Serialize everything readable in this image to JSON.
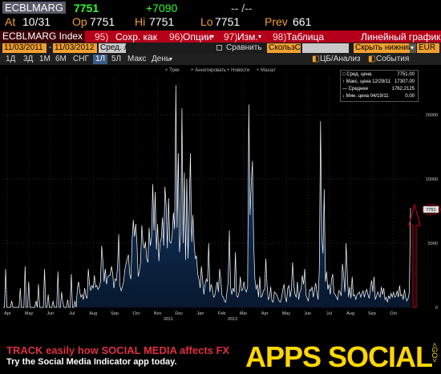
{
  "quote": {
    "ticker": "ECBLMARG",
    "last": "7751",
    "change": "+7090",
    "dash": "-- /--",
    "at_label": "At",
    "at": "10/31",
    "op_label": "Op",
    "op": "7751",
    "hi_label": "Hi",
    "hi": "7751",
    "lo_label": "Lo",
    "lo": "7751",
    "prev_label": "Prev",
    "prev": "661"
  },
  "menu": {
    "security": "ECBLMARG Index",
    "save_num": "95)",
    "save": "Сохр. как",
    "options_num": "96)",
    "options": "Опции",
    "edit_num": "97)",
    "edit": "Изм.",
    "table_num": "98)",
    "table": "Таблица",
    "chart_type": "Линейный график"
  },
  "range": {
    "start": "11/03/2011",
    "end": "11/03/2012",
    "avg_lines": "Сред. линия",
    "compare": "Сравнить",
    "moving_avg": "СкользСр",
    "hide_lower": "Скрыть нижний",
    "currency": "EUR"
  },
  "periods": [
    "1Д",
    "3Д",
    "1М",
    "6М",
    "СНГ",
    "1Л",
    "5Л",
    "Макс"
  ],
  "selected_period": "1Л",
  "frequency": "День",
  "tools": {
    "analysis": "ЦБ/Анализ",
    "events": "События"
  },
  "toolbar": [
    "Трек",
    "Аннотировать",
    "Новости",
    "Масшт"
  ],
  "legend": {
    "rows": [
      {
        "label": "Сред. цена",
        "value": "7751.00"
      },
      {
        "label": "Макс. цена 12/29/11",
        "value": "17307.00"
      },
      {
        "label": "Среднее",
        "value": "1762.2125"
      },
      {
        "label": "Мин. цена 04/19/11",
        "value": "0.00"
      }
    ]
  },
  "banner": {
    "line1": "TRACK easily how SOCIAL MEDIA affects FX",
    "line2": "Try the Social Media Indicator app today.",
    "brand": "APPS SOCIAL",
    "sub": "<GO>"
  },
  "colors": {
    "accent": "#b4001a",
    "line": "#ffffff",
    "fill": "#0b2a55",
    "marker": "#d0001c"
  },
  "chart_data": {
    "type": "area",
    "series": [
      {
        "values": [
          0,
          0,
          3000,
          0,
          0,
          0,
          0,
          500,
          0,
          0,
          0,
          0,
          0,
          0,
          1500,
          0,
          0,
          0,
          3200,
          0,
          0,
          2000,
          0,
          0,
          0,
          0,
          0,
          500,
          0,
          1800,
          0,
          0,
          0,
          0,
          3000,
          0,
          0,
          1000,
          0,
          0,
          0,
          500,
          0,
          0,
          0,
          2800,
          0,
          0,
          1200,
          400,
          0,
          0,
          0,
          600,
          0,
          0,
          2600,
          0,
          0,
          500,
          0,
          1500,
          2000,
          1200,
          800,
          1000,
          600,
          1500,
          900,
          700,
          3000,
          1800,
          1300,
          1700,
          1500,
          2500,
          1600,
          1700,
          1400,
          1600,
          2000,
          4800,
          3600,
          2000,
          3000,
          1800,
          2400,
          2500,
          2500,
          3200,
          2700,
          1500,
          2200,
          2100,
          3100,
          5700,
          1700,
          1300,
          1600,
          2000,
          2900,
          3400,
          3800,
          4100,
          2600,
          2200,
          5300,
          6800,
          5500,
          6500,
          5000,
          2400,
          2800,
          3600,
          6400,
          5000,
          4600,
          5100,
          3800,
          3500,
          6200,
          4800,
          5500,
          9600,
          6000,
          9000,
          4500,
          6500,
          3600,
          5000,
          5400,
          7000,
          4800,
          9400,
          8000,
          4600,
          8500,
          5100,
          5000,
          5700,
          7400,
          6100,
          17307,
          6200,
          12000,
          4300,
          5800,
          15500,
          5000,
          10500,
          3700,
          10000,
          3800,
          7800,
          12000,
          5100,
          7200,
          5000,
          3800,
          4000,
          2600,
          2200,
          1500,
          3200,
          2200,
          1000,
          1800,
          2200,
          2000,
          5000,
          1200,
          1800,
          1500,
          800,
          900,
          1500,
          2000,
          1200,
          3000,
          2100,
          900,
          800,
          500,
          400,
          1200,
          2000,
          6000,
          1600,
          1000,
          1500,
          1200,
          4300,
          900,
          800,
          1200,
          2400,
          1300,
          1400,
          2000,
          1400,
          1200,
          1600,
          15800,
          7200,
          9600,
          11400,
          5000,
          2200,
          1400,
          1800,
          800,
          2400,
          800,
          900,
          1300,
          1400,
          3800,
          1700,
          600,
          800,
          1600,
          500,
          400,
          1200,
          1100,
          1000,
          700,
          500,
          400,
          800,
          1400,
          1800,
          800,
          400,
          1500,
          1700,
          800,
          1400,
          3500,
          1800,
          1000,
          800,
          2000,
          600,
          1200,
          1400,
          2500,
          1800,
          3000,
          1000,
          700,
          500,
          1400,
          1300,
          1600,
          800,
          1400,
          1900,
          1200,
          600,
          3000,
          14500,
          5400,
          4200,
          9200,
          2000,
          2800,
          1400,
          1800,
          1000,
          2200,
          2600,
          1100,
          1000,
          800,
          600,
          1300,
          1200,
          900,
          3400,
          2500,
          1200,
          5000,
          2600,
          800,
          1600,
          700,
          2400,
          900,
          1000,
          600,
          1000,
          1100,
          1200,
          800,
          1100,
          1300,
          800,
          1200,
          1400,
          1000,
          700,
          1500,
          2100,
          1200,
          2400,
          600,
          900,
          1200,
          1000,
          800,
          1600,
          1000,
          1500,
          600,
          800,
          400,
          900,
          700,
          1100,
          800,
          1200,
          800,
          900,
          1300,
          800,
          1700,
          900,
          1000,
          600,
          1400,
          800,
          500,
          700,
          1200,
          7751
        ]
      }
    ],
    "last_value": "7751",
    "x_tick_labels": [
      "Apr",
      "May",
      "Jun",
      "Jul",
      "Aug",
      "Sep",
      "Oct",
      "Nov",
      "Dec",
      "Jan",
      "Feb",
      "Mar",
      "Apr",
      "May",
      "Jun",
      "Jul",
      "Aug",
      "Sep",
      "Oct"
    ],
    "x_year_labels": [
      "2011",
      "2012"
    ],
    "y_ticks": [
      0,
      5000,
      10000,
      15000
    ],
    "ylim": [
      0,
      18000
    ],
    "grid": true,
    "legend_position": "top-right"
  }
}
